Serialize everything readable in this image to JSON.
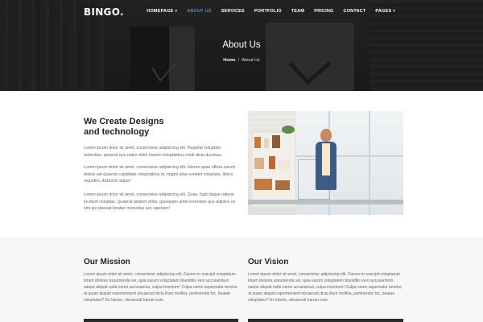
{
  "header": {
    "logo": "BINGO.",
    "nav": [
      {
        "label": "HOMEPAGE",
        "dropdown": true,
        "active": false
      },
      {
        "label": "ABOUT US",
        "dropdown": false,
        "active": true
      },
      {
        "label": "SERVICES",
        "dropdown": false,
        "active": false
      },
      {
        "label": "PORTFOLIO",
        "dropdown": false,
        "active": false
      },
      {
        "label": "TEAM",
        "dropdown": false,
        "active": false
      },
      {
        "label": "PRICING",
        "dropdown": false,
        "active": false
      },
      {
        "label": "CONTACT",
        "dropdown": false,
        "active": false
      },
      {
        "label": "PAGES",
        "dropdown": true,
        "active": false
      }
    ],
    "accent_color": "#2f9bdb"
  },
  "hero": {
    "title": "About Us",
    "breadcrumb": {
      "home": "Home",
      "separator": "/",
      "current": "About Us"
    }
  },
  "intro": {
    "title_line1": "We Create Designs",
    "title_line2": "and technology",
    "paragraphs": [
      "Lorem ipsum dolor sit amet, consectetur adipisicing elit. Repellat voluptate molestias, quaerat quo natus dolor harum voluptatibus modi dicta ducimus.",
      "Lorem ipsum dolor sit amet, consectetur adipisicing elit. Harum quae officia earum dolore est quaerat cupiditate voluptatibus id, magni alias veniam voluptate, libero expedito, distinctio atque!",
      "Lorem ipsum dolor sit amet, consectetur adipisicing elit. Quas, fugit itaque ratione incidunt voluptas. Quaerat quidem dolor, quisquam amet inventore quo adipisci ex sint qui placeat beatae molestias aut, aperiam!"
    ]
  },
  "mission": {
    "title": "Our Mission",
    "text": "Lorem ipsum dolor sit amet, consectetur adipisicing elit. Facere in suscipit voluptatum totam dolores assumenda vel, quia earum voluptatem blanditiis vero accusantium saepe aliquid nulla nemo accusamus, culpa inventore! Culpa nemo aspernatur tenetur, at quam aliquid reprehenderit obcaecati dicta illum mollitia, perferendis hic, beatae voluptates? Ex labore, obcaecati harum eum."
  },
  "vision": {
    "title": "Our Vision",
    "text": "Lorem ipsum dolor sit amet, consectetur adipisicing elit. Facere in suscipit voluptatum totam dolores assumenda vel, quia earum voluptatem blanditiis vero accusantium saepe aliquid nulla nemo accusamus, culpa inventore! Culpa nemo aspernatur tenetur, at quam aliquid reprehenderit obcaecati dicta illum mollitia, perferendis hic, beatae voluptates? Ex labore, obcaecati harum eum."
  }
}
